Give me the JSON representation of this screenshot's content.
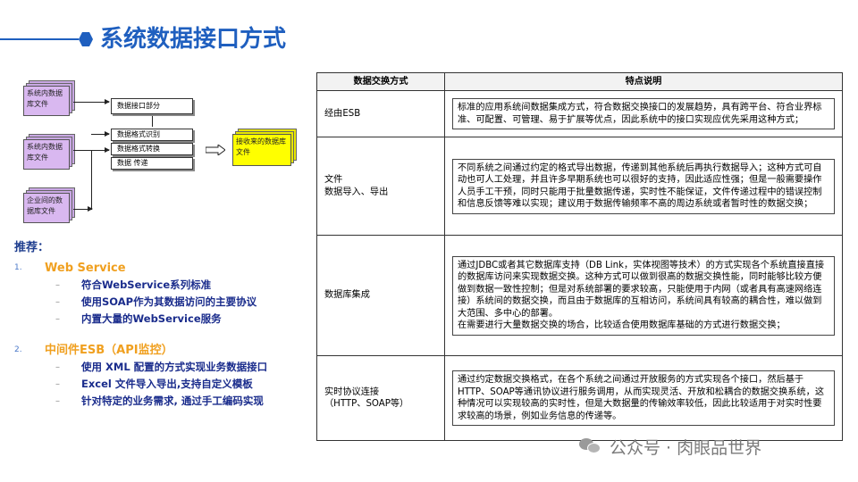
{
  "title": "系统数据接口方式",
  "diagram": {
    "interface_label": "数据接口部分",
    "processes": [
      "数据格式识别",
      "数据格式转换",
      "数据    传递"
    ],
    "sources": [
      "系统内数据库文件",
      "系统内数据库文件",
      "企业间的数据库文件"
    ],
    "target": "接收来的数据库文件"
  },
  "recommend": {
    "heading": "推荐：",
    "items": [
      {
        "num": "1.",
        "label": "Web Service",
        "subs": [
          "符合WebService系列标准",
          "使用SOAP作为其数据访问的主要协议",
          "内置大量的WebService服务"
        ]
      },
      {
        "num": "2.",
        "label": "中间件ESB（API监控）",
        "subs": [
          "使用 XML 配置的方式实现业务数据接口",
          "Excel 文件导入导出,支持自定义模板",
          "针对特定的业务需求, 通过手工编码实现"
        ]
      }
    ]
  },
  "table": {
    "headers": [
      "数据交换方式",
      "特点说明"
    ],
    "rows": [
      {
        "method": "经由ESB",
        "desc": "标准的应用系统间数据集成方式，符合数据交换接口的发展趋势，具有跨平台、符合业界标准、可配置、可管理、易于扩展等优点，因此系统中的接口实现应优先采用这种方式；"
      },
      {
        "method": "文件\n数据导入、导出",
        "desc": "不同系统之间通过约定的格式导出数据，传递到其他系统后再执行数据导入；这种方式可自动也可人工处理，并且许多早期系统也可以很好的支持，因此适应性强；但是一般需要操作人员手工干预，同时只能用于批量数据传递，实时性不能保证，文件传递过程中的错误控制和信息反馈等难以实现；建议用于数据传输频率不高的周边系统或者暂时性的数据交换；"
      },
      {
        "method": "数据库集成",
        "desc": "通过JDBC或者其它数据库支持（DB Link，实体视图等技术）的方式实现各个系统直接直接的数据库访问来实现数据交换。这种方式可以做到很高的数据交换性能，同时能够比较方便做到数据一致性控制；但是对系统部署的要求较高，只能使用于内网（或者具有高速网络连接）系统间的数据交换，而且由于数据库的互相访问，系统间具有较高的耦合性，难以做到大范围、多中心的部署。\n在需要进行大量数据交换的场合，比较适合使用数据库基础的方式进行数据交换；"
      },
      {
        "method": "实时协议连接\n（HTTP、SOAP等）",
        "desc": "通过约定数据交换格式，在各个系统之间通过开放服务的方式实现各个接口，然后基于HTTP、SOAP等通讯协议进行服务调用，从而实现灵活、开放和松耦合的数据交换系统，这种情况可以实现较高的实时性，但是大数据量的传输效率较低，因此比较适用于对实时性要求较高的场景，例如业务信息的传递等。"
      }
    ]
  },
  "watermark": "公众号 · 肉眼品世界",
  "colors": {
    "accent": "#1f5fbf",
    "orange": "#f0a020",
    "navy": "#1a2c8c"
  }
}
